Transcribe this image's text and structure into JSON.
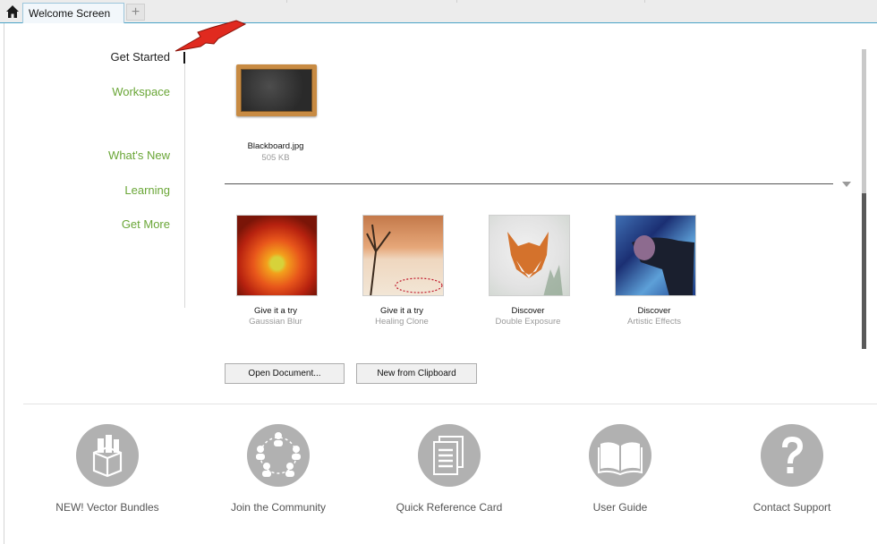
{
  "window": {
    "tab_title": "Welcome Screen",
    "add_tab_symbol": "+"
  },
  "nav": {
    "items": [
      {
        "label": "Get Started",
        "active": true
      },
      {
        "label": "Workspace",
        "active": false
      },
      {
        "label": "What's New",
        "active": false
      },
      {
        "label": "Learning",
        "active": false
      },
      {
        "label": "Get More",
        "active": false
      }
    ]
  },
  "recent_files": [
    {
      "name": "Blackboard.jpg",
      "size": "505 KB"
    }
  ],
  "samples": [
    {
      "title": "Give it a try",
      "subtitle": "Gaussian Blur"
    },
    {
      "title": "Give it a try",
      "subtitle": "Healing Clone"
    },
    {
      "title": "Discover",
      "subtitle": "Double Exposure"
    },
    {
      "title": "Discover",
      "subtitle": "Artistic Effects"
    }
  ],
  "buttons": {
    "open_document": "Open Document...",
    "new_from_clipboard": "New from Clipboard"
  },
  "bottom_links": [
    {
      "label": "NEW! Vector Bundles",
      "icon": "vector-bundles-icon"
    },
    {
      "label": "Join the Community",
      "icon": "community-icon"
    },
    {
      "label": "Quick Reference Card",
      "icon": "reference-card-icon"
    },
    {
      "label": "User Guide",
      "icon": "book-icon"
    },
    {
      "label": "Contact Support",
      "icon": "question-icon"
    }
  ],
  "colors": {
    "nav_link": "#6aa637",
    "nav_active": "#222222",
    "icon_circle": "#b1b1b1",
    "tab_accent": "#4aa3c7",
    "annotation_arrow": "#e02a1f"
  }
}
